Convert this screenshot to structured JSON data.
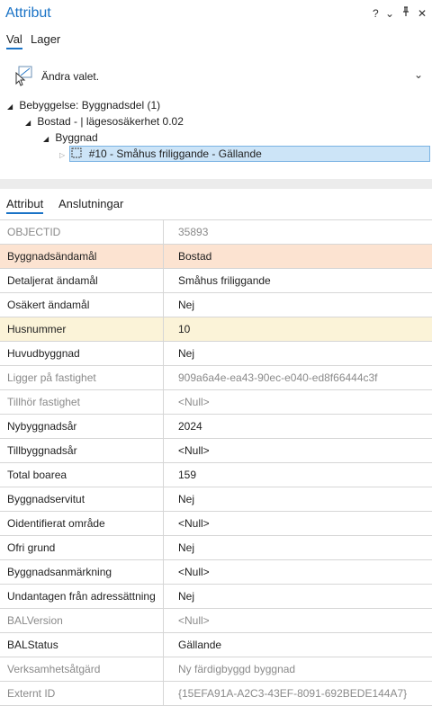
{
  "header": {
    "title": "Attribut",
    "help": "?",
    "menu": "⌄",
    "pin": "⊥",
    "close": "✕"
  },
  "top_tabs": [
    "Val",
    "Lager"
  ],
  "change_selection": {
    "label": "Ändra valet.",
    "chevron": "⌄"
  },
  "tree": [
    {
      "label": "Bebyggelse: Byggnadsdel (1)"
    },
    {
      "label": "Bostad -  | lägesosäkerhet 0.02"
    },
    {
      "label": "Byggnad"
    },
    {
      "label": "#10 - Småhus friliggande - Gällande"
    }
  ],
  "attr_tabs": [
    "Attribut",
    "Anslutningar"
  ],
  "attributes": [
    {
      "name": "OBJECTID",
      "value": "35893",
      "readonly": true
    },
    {
      "name": "Byggnadsändamål",
      "value": "Bostad",
      "highlight": "orange"
    },
    {
      "name": "Detaljerat ändamål",
      "value": "Småhus friliggande"
    },
    {
      "name": "Osäkert ändamål",
      "value": "Nej"
    },
    {
      "name": "Husnummer",
      "value": "10",
      "highlight": "yellow"
    },
    {
      "name": "Huvudbyggnad",
      "value": "Nej"
    },
    {
      "name": "Ligger på fastighet",
      "value": "909a6a4e-ea43-90ec-e040-ed8f66444c3f",
      "readonly": true
    },
    {
      "name": "Tillhör fastighet",
      "value": "<Null>",
      "readonly": true
    },
    {
      "name": "Nybyggnadsår",
      "value": "2024"
    },
    {
      "name": "Tillbyggnadsår",
      "value": "<Null>"
    },
    {
      "name": "Total boarea",
      "value": "159"
    },
    {
      "name": "Byggnadservitut",
      "value": "Nej"
    },
    {
      "name": "Oidentifierat område",
      "value": "<Null>"
    },
    {
      "name": "Ofri grund",
      "value": "Nej"
    },
    {
      "name": "Byggnadsanmärkning",
      "value": "<Null>"
    },
    {
      "name": "Undantagen från adressättning",
      "value": "Nej"
    },
    {
      "name": "BALVersion",
      "value": "<Null>",
      "readonly": true
    },
    {
      "name": "BALStatus",
      "value": "Gällande"
    },
    {
      "name": "Verksamhetsåtgärd",
      "value": "Ny färdigbyggd byggnad",
      "readonly": true
    },
    {
      "name": "Externt ID",
      "value": "{15EFA91A-A2C3-43EF-8091-692BEDE144A7}",
      "readonly": true
    }
  ],
  "colors": {
    "accent": "#1a73c6",
    "highlight_orange": "#fce3d1",
    "highlight_yellow": "#fbf3d8",
    "selection": "#cce4f7"
  }
}
